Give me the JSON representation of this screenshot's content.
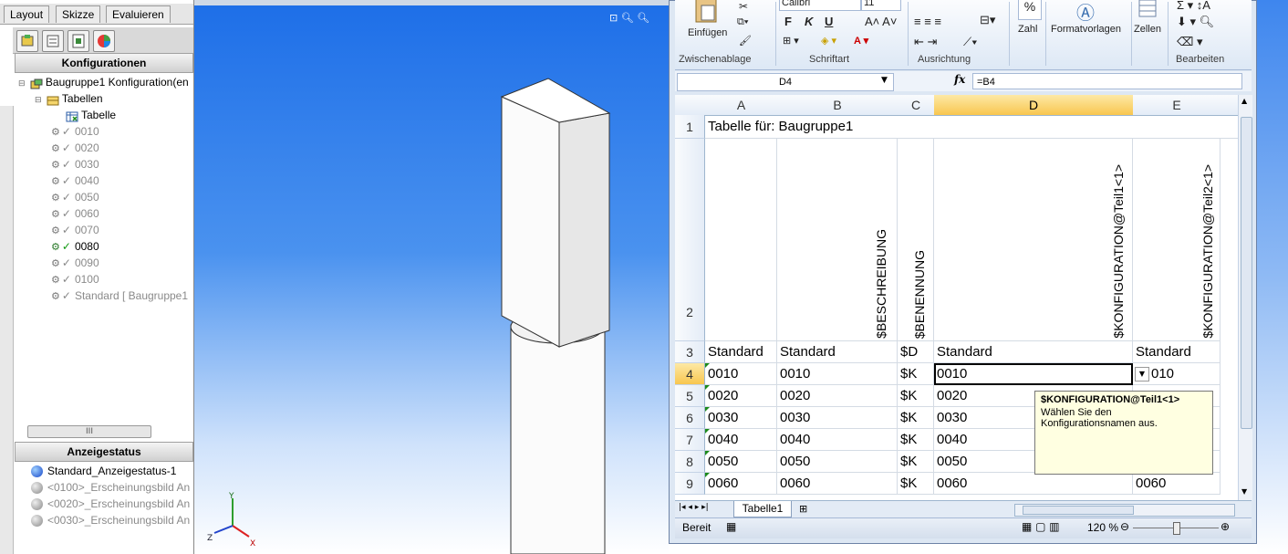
{
  "solidworks": {
    "tabs": [
      "Layout",
      "Skizze",
      "Evaluieren"
    ],
    "config_header": "Konfigurationen",
    "tree_root": "Baugruppe1 Konfiguration(en",
    "tables_node": "Tabellen",
    "table_item": "Tabelle",
    "configs": [
      "0010",
      "0020",
      "0030",
      "0040",
      "0050",
      "0060",
      "0070",
      "0080",
      "0090",
      "0100",
      "Standard [ Baugruppe1"
    ],
    "active_config": "0080",
    "scroll_glyph": "III",
    "display_header": "Anzeigestatus",
    "display_states": [
      "Standard_Anzeigestatus-1",
      "<0100>_Erscheinungsbild An",
      "<0020>_Erscheinungsbild An",
      "<0030>_Erscheinungsbild An"
    ],
    "axis": {
      "x": "X",
      "y": "Y",
      "z": "Z"
    }
  },
  "excel": {
    "ribbon": {
      "paste_label": "Einfügen",
      "clipboard_label": "Zwischenablage",
      "font_name": "Calibri",
      "font_size": "11",
      "font_group_label": "Schriftart",
      "alignment_label": "Ausrichtung",
      "number_label": "Zahl",
      "styles_label": "Formatvorlagen",
      "cells_label": "Zellen",
      "editing_label": "Bearbeiten",
      "bold": "F",
      "italic": "K",
      "underline": "U",
      "percent": "%"
    },
    "name_box": "D4",
    "fx_symbol": "fx",
    "formula": "=B4",
    "columns": [
      "A",
      "B",
      "C",
      "D",
      "E"
    ],
    "rows": [
      "1",
      "2",
      "3",
      "4",
      "5",
      "6",
      "7",
      "8",
      "9"
    ],
    "title_cell": "Tabelle für: Baugruppe1",
    "vertical_headers": {
      "c_b": "$BESCHREIBUNG",
      "c_c": "$BENENNUNG",
      "c_d": "$KONFIGURATION@Teil1<1>",
      "c_e": "$KONFIGURATION@Teil2<1>"
    },
    "row3": [
      "Standard",
      "Standard",
      "$D",
      "Standard",
      "Standard"
    ],
    "data_rows": [
      [
        "0010",
        "0010",
        "$K",
        "0010",
        "010"
      ],
      [
        "0020",
        "0020",
        "$K",
        "0020",
        ""
      ],
      [
        "0030",
        "0030",
        "$K",
        "0030",
        ""
      ],
      [
        "0040",
        "0040",
        "$K",
        "0040",
        ""
      ],
      [
        "0050",
        "0050",
        "$K",
        "0050",
        ""
      ],
      [
        "0060",
        "0060",
        "$K",
        "0060",
        "0060"
      ]
    ],
    "tooltip": {
      "title": "$KONFIGURATION@Teil1<1>",
      "body": "Wählen Sie den Konfigurationsnamen aus."
    },
    "sheet_tab": "Tabelle1",
    "status": "Bereit",
    "zoom": "120 %"
  }
}
